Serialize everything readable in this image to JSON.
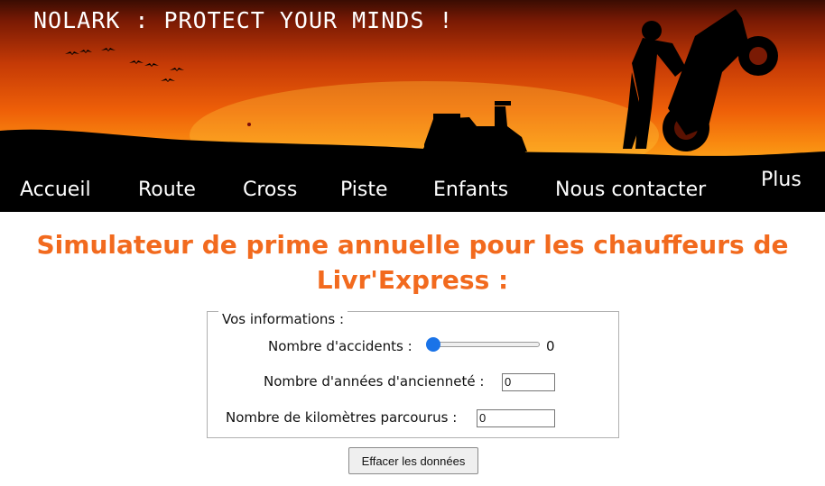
{
  "header": {
    "site_title": "NOLARK : PROTECT YOUR MINDS !"
  },
  "nav": {
    "items": [
      {
        "label": "Accueil"
      },
      {
        "label": "Route"
      },
      {
        "label": "Cross"
      },
      {
        "label": "Piste"
      },
      {
        "label": "Enfants"
      },
      {
        "label": "Nous contacter"
      },
      {
        "label": "Plus"
      }
    ]
  },
  "main": {
    "title_line1": "Simulateur de prime annuelle pour les chauffeurs de",
    "title_line2": "Livr'Express :",
    "form": {
      "legend": "Vos informations :",
      "accidents": {
        "label": "Nombre d'accidents :",
        "value": 0,
        "value_text": "0"
      },
      "seniority": {
        "label": "Nombre d'années d'ancienneté :",
        "value": "0"
      },
      "kilometers": {
        "label": "Nombre de kilomètres parcourus :",
        "value": "0"
      },
      "reset_label": "Effacer les données"
    }
  },
  "colors": {
    "title": "#f26a1e",
    "nav_text": "#ffffff",
    "slider_thumb": "#1a73e8"
  }
}
